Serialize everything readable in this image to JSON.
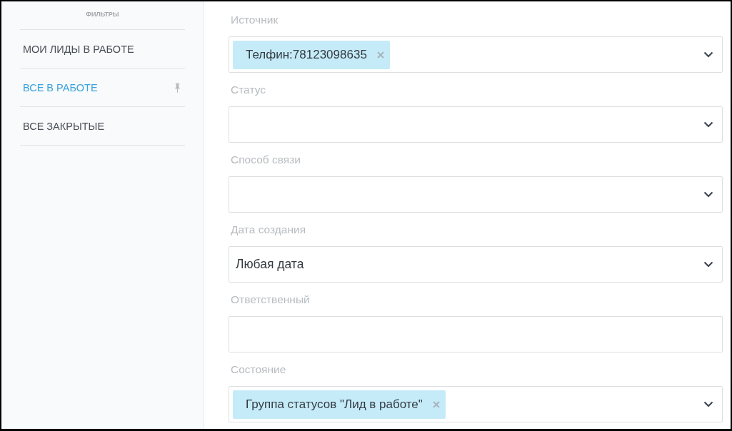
{
  "sidebar": {
    "title": "ФИЛЬТРЫ",
    "items": [
      {
        "label": "МОИ ЛИДЫ В РАБОТЕ",
        "selected": false,
        "pinned": false
      },
      {
        "label": "ВСЕ В РАБОТЕ",
        "selected": true,
        "pinned": true
      },
      {
        "label": "ВСЕ ЗАКРЫТЫЕ",
        "selected": false,
        "pinned": false
      }
    ]
  },
  "filters": [
    {
      "label": "Источник",
      "kind": "select",
      "tags": [
        "Телфин:78123098635"
      ]
    },
    {
      "label": "Статус",
      "kind": "select"
    },
    {
      "label": "Способ связи",
      "kind": "select"
    },
    {
      "label": "Дата создания",
      "kind": "select",
      "value": "Любая дата"
    },
    {
      "label": "Ответственный",
      "kind": "text"
    },
    {
      "label": "Состояние",
      "kind": "select",
      "tags": [
        "Группа статусов \"Лид в работе\""
      ]
    }
  ]
}
